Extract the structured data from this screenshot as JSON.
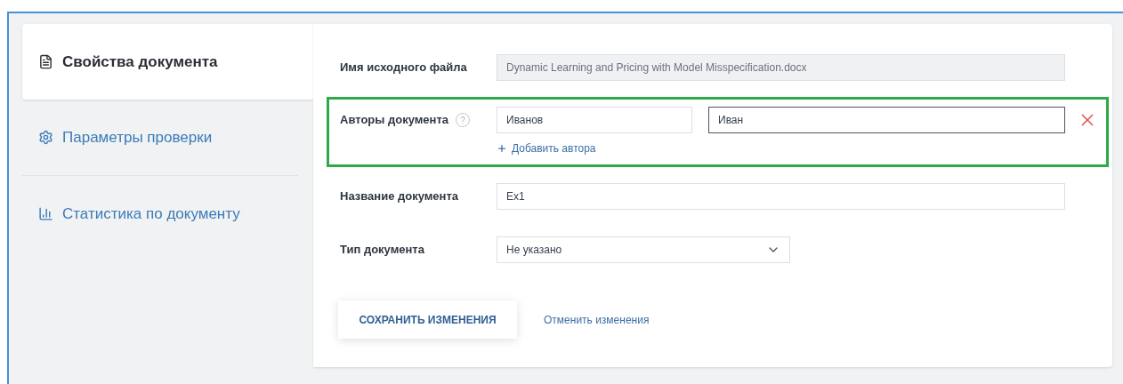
{
  "sidebar": {
    "items": [
      {
        "label": "Свойства документа",
        "kind": "document",
        "selected": true
      },
      {
        "label": "Параметры проверки",
        "kind": "gear",
        "selected": false
      },
      {
        "label": "Статистика по документу",
        "kind": "chart",
        "selected": false
      }
    ]
  },
  "form": {
    "rows": [
      {
        "kind": "readonly",
        "label": "Имя исходного файла",
        "value": "Dynamic Learning and Pricing with Model Misspecification.docx"
      },
      {
        "kind": "authors",
        "label": "Авторы документа",
        "highlighted": true,
        "help": "?",
        "authors": [
          {
            "last_name": "Иванов",
            "first_name": "Иван",
            "focused": true
          }
        ],
        "add_label": "Добавить автора"
      },
      {
        "kind": "text",
        "label": "Название документа",
        "value": "Ex1"
      },
      {
        "kind": "select",
        "label": "Тип документа",
        "value": "Не указано"
      }
    ],
    "save_button": "СОХРАНИТЬ ИЗМЕНЕНИЯ",
    "cancel_link": "Отменить изменения"
  }
}
